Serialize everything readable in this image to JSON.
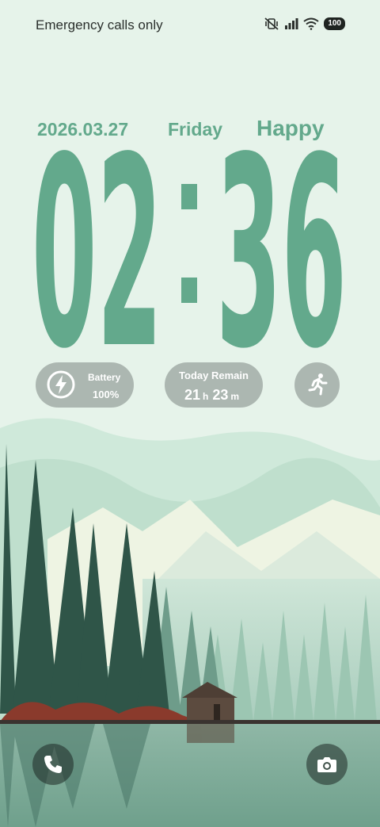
{
  "status_bar": {
    "carrier_text": "Emergency calls only",
    "battery_level": "100",
    "icons": [
      "mute-vibrate-icon",
      "signal-icon",
      "wifi-icon",
      "battery-icon"
    ]
  },
  "lockscreen": {
    "date": "2026.03.27",
    "weekday": "Friday",
    "greeting": "Happy",
    "time": {
      "hours": "02",
      "minutes": "36"
    }
  },
  "widgets": {
    "battery": {
      "label": "Battery",
      "value": "100%",
      "icon": "lightning-icon"
    },
    "remain": {
      "label": "Today Remain",
      "hours": "21",
      "hours_unit": "h",
      "minutes": "23",
      "minutes_unit": "m"
    },
    "activity": {
      "icon": "running-person-icon"
    }
  },
  "shortcuts": {
    "left": "phone-icon",
    "right": "camera-icon"
  },
  "colors": {
    "accent": "#63a98c",
    "background": "#e6f3ea",
    "pill": "#98a39d"
  }
}
